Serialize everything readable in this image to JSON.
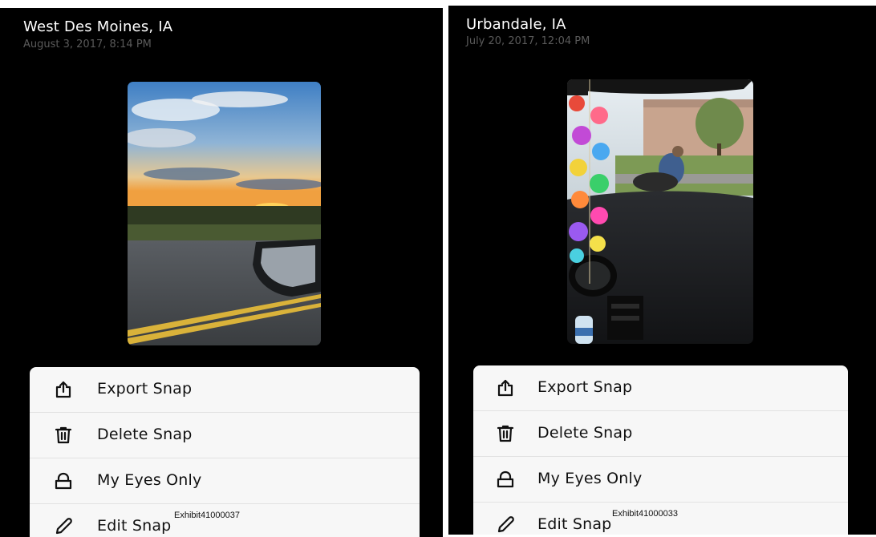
{
  "left": {
    "location": "West Des Moines, IA",
    "date": "August 3, 2017, 8:14 PM",
    "menu": [
      {
        "label": "Export Snap",
        "icon": "export-icon"
      },
      {
        "label": "Delete Snap",
        "icon": "trash-icon"
      },
      {
        "label": "My Eyes Only",
        "icon": "lock-icon"
      },
      {
        "label": "Edit Snap",
        "icon": "pencil-icon"
      }
    ],
    "exhibit": "Exhibit41000037"
  },
  "right": {
    "location": "Urbandale, IA",
    "date": "July 20, 2017, 12:04 PM",
    "menu": [
      {
        "label": "Export Snap",
        "icon": "export-icon"
      },
      {
        "label": "Delete Snap",
        "icon": "trash-icon"
      },
      {
        "label": "My Eyes Only",
        "icon": "lock-icon"
      },
      {
        "label": "Edit Snap",
        "icon": "pencil-icon"
      }
    ],
    "exhibit": "Exhibit41000033"
  },
  "colors": {
    "background": "#000000",
    "menu_background": "#f7f7f7",
    "date_text": "#5a5a5a"
  }
}
